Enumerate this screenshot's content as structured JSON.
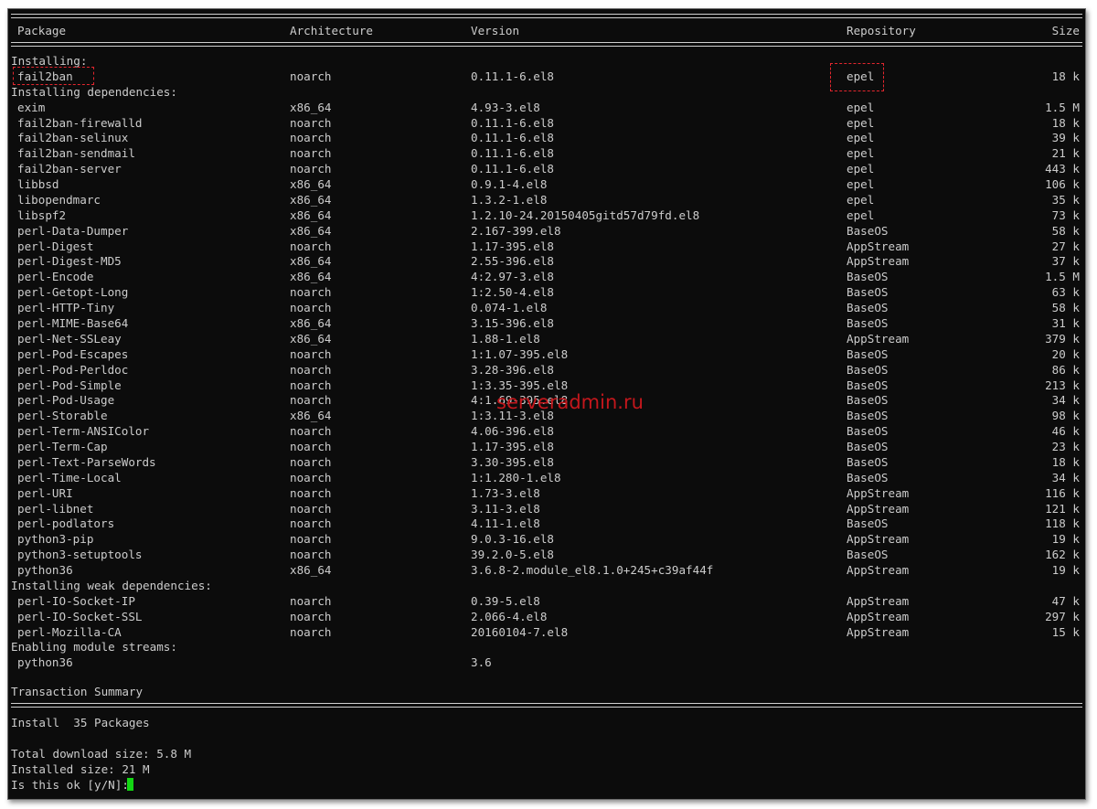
{
  "headers": {
    "package": "Package",
    "architecture": "Architecture",
    "version": "Version",
    "repository": "Repository",
    "size": "Size"
  },
  "sections": [
    {
      "title": "Installing:",
      "rows": [
        {
          "package": "fail2ban",
          "arch": "noarch",
          "version": "0.11.1-6.el8",
          "repo": "epel",
          "size": "18 k"
        }
      ]
    },
    {
      "title": "Installing dependencies:",
      "rows": [
        {
          "package": "exim",
          "arch": "x86_64",
          "version": "4.93-3.el8",
          "repo": "epel",
          "size": "1.5 M"
        },
        {
          "package": "fail2ban-firewalld",
          "arch": "noarch",
          "version": "0.11.1-6.el8",
          "repo": "epel",
          "size": "18 k"
        },
        {
          "package": "fail2ban-selinux",
          "arch": "noarch",
          "version": "0.11.1-6.el8",
          "repo": "epel",
          "size": "39 k"
        },
        {
          "package": "fail2ban-sendmail",
          "arch": "noarch",
          "version": "0.11.1-6.el8",
          "repo": "epel",
          "size": "21 k"
        },
        {
          "package": "fail2ban-server",
          "arch": "noarch",
          "version": "0.11.1-6.el8",
          "repo": "epel",
          "size": "443 k"
        },
        {
          "package": "libbsd",
          "arch": "x86_64",
          "version": "0.9.1-4.el8",
          "repo": "epel",
          "size": "106 k"
        },
        {
          "package": "libopendmarc",
          "arch": "x86_64",
          "version": "1.3.2-1.el8",
          "repo": "epel",
          "size": "35 k"
        },
        {
          "package": "libspf2",
          "arch": "x86_64",
          "version": "1.2.10-24.20150405gitd57d79fd.el8",
          "repo": "epel",
          "size": "73 k"
        },
        {
          "package": "perl-Data-Dumper",
          "arch": "x86_64",
          "version": "2.167-399.el8",
          "repo": "BaseOS",
          "size": "58 k"
        },
        {
          "package": "perl-Digest",
          "arch": "noarch",
          "version": "1.17-395.el8",
          "repo": "AppStream",
          "size": "27 k"
        },
        {
          "package": "perl-Digest-MD5",
          "arch": "x86_64",
          "version": "2.55-396.el8",
          "repo": "AppStream",
          "size": "37 k"
        },
        {
          "package": "perl-Encode",
          "arch": "x86_64",
          "version": "4:2.97-3.el8",
          "repo": "BaseOS",
          "size": "1.5 M"
        },
        {
          "package": "perl-Getopt-Long",
          "arch": "noarch",
          "version": "1:2.50-4.el8",
          "repo": "BaseOS",
          "size": "63 k"
        },
        {
          "package": "perl-HTTP-Tiny",
          "arch": "noarch",
          "version": "0.074-1.el8",
          "repo": "BaseOS",
          "size": "58 k"
        },
        {
          "package": "perl-MIME-Base64",
          "arch": "x86_64",
          "version": "3.15-396.el8",
          "repo": "BaseOS",
          "size": "31 k"
        },
        {
          "package": "perl-Net-SSLeay",
          "arch": "x86_64",
          "version": "1.88-1.el8",
          "repo": "AppStream",
          "size": "379 k"
        },
        {
          "package": "perl-Pod-Escapes",
          "arch": "noarch",
          "version": "1:1.07-395.el8",
          "repo": "BaseOS",
          "size": "20 k"
        },
        {
          "package": "perl-Pod-Perldoc",
          "arch": "noarch",
          "version": "3.28-396.el8",
          "repo": "BaseOS",
          "size": "86 k"
        },
        {
          "package": "perl-Pod-Simple",
          "arch": "noarch",
          "version": "1:3.35-395.el8",
          "repo": "BaseOS",
          "size": "213 k"
        },
        {
          "package": "perl-Pod-Usage",
          "arch": "noarch",
          "version": "4:1.69-395.el8",
          "repo": "BaseOS",
          "size": "34 k"
        },
        {
          "package": "perl-Storable",
          "arch": "x86_64",
          "version": "1:3.11-3.el8",
          "repo": "BaseOS",
          "size": "98 k"
        },
        {
          "package": "perl-Term-ANSIColor",
          "arch": "noarch",
          "version": "4.06-396.el8",
          "repo": "BaseOS",
          "size": "46 k"
        },
        {
          "package": "perl-Term-Cap",
          "arch": "noarch",
          "version": "1.17-395.el8",
          "repo": "BaseOS",
          "size": "23 k"
        },
        {
          "package": "perl-Text-ParseWords",
          "arch": "noarch",
          "version": "3.30-395.el8",
          "repo": "BaseOS",
          "size": "18 k"
        },
        {
          "package": "perl-Time-Local",
          "arch": "noarch",
          "version": "1:1.280-1.el8",
          "repo": "BaseOS",
          "size": "34 k"
        },
        {
          "package": "perl-URI",
          "arch": "noarch",
          "version": "1.73-3.el8",
          "repo": "AppStream",
          "size": "116 k"
        },
        {
          "package": "perl-libnet",
          "arch": "noarch",
          "version": "3.11-3.el8",
          "repo": "AppStream",
          "size": "121 k"
        },
        {
          "package": "perl-podlators",
          "arch": "noarch",
          "version": "4.11-1.el8",
          "repo": "BaseOS",
          "size": "118 k"
        },
        {
          "package": "python3-pip",
          "arch": "noarch",
          "version": "9.0.3-16.el8",
          "repo": "AppStream",
          "size": "19 k"
        },
        {
          "package": "python3-setuptools",
          "arch": "noarch",
          "version": "39.2.0-5.el8",
          "repo": "BaseOS",
          "size": "162 k"
        },
        {
          "package": "python36",
          "arch": "x86_64",
          "version": "3.6.8-2.module_el8.1.0+245+c39af44f",
          "repo": "AppStream",
          "size": "19 k"
        }
      ]
    },
    {
      "title": "Installing weak dependencies:",
      "rows": [
        {
          "package": "perl-IO-Socket-IP",
          "arch": "noarch",
          "version": "0.39-5.el8",
          "repo": "AppStream",
          "size": "47 k"
        },
        {
          "package": "perl-IO-Socket-SSL",
          "arch": "noarch",
          "version": "2.066-4.el8",
          "repo": "AppStream",
          "size": "297 k"
        },
        {
          "package": "perl-Mozilla-CA",
          "arch": "noarch",
          "version": "20160104-7.el8",
          "repo": "AppStream",
          "size": "15 k"
        }
      ]
    },
    {
      "title": "Enabling module streams:",
      "rows": [
        {
          "package": "python36",
          "arch": "",
          "version": "3.6",
          "repo": "",
          "size": ""
        }
      ]
    }
  ],
  "summary": {
    "title": "Transaction Summary",
    "install_line": "Install  35 Packages",
    "total_download": "Total download size: 5.8 M",
    "installed_size": "Installed size: 21 M",
    "prompt": "Is this ok [y/N]: "
  },
  "watermark": "serveradmin.ru",
  "colors": {
    "background": "#0c0c0c",
    "text": "#cccccc",
    "highlight": "#e3262e",
    "cursor": "#13d613",
    "watermark": "#c4171c"
  }
}
